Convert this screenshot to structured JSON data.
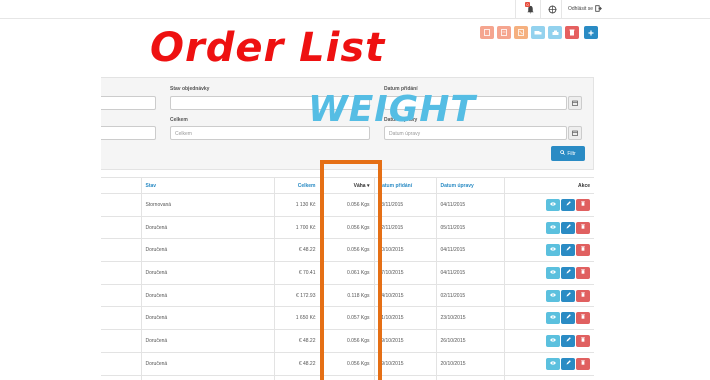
{
  "topbar": {
    "notification_count": "0",
    "logout_label": "Odhlásit se"
  },
  "icons": {
    "bell": "bell-icon",
    "globe": "globe-icon",
    "logout": "logout-icon",
    "calendar": "calendar-icon",
    "search": "search-icon",
    "eye": "eye-icon",
    "pencil": "pencil-icon",
    "trash": "trash-icon",
    "sort": "sort-icon"
  },
  "overlay": {
    "title": "Order List",
    "subtitle": "WEIGHT"
  },
  "toolbar_colors": [
    "#f39c82",
    "#f39c82",
    "#f3a77b",
    "#8fd0ee",
    "#8fd0ee",
    "#e06060",
    "#2a8bc4"
  ],
  "filters": {
    "state_label": "Stav objednávky",
    "total_label": "Celkem",
    "total_placeholder": "Celkem",
    "date_added_label": "Datum přidání",
    "date_modified_label": "Datum úpravy",
    "date_modified_placeholder": "Datum úpravy",
    "filter_button": "Filtr"
  },
  "table": {
    "headers": {
      "status": "Stav",
      "total": "Celkem",
      "weight": "Váha",
      "date_added": "Datum přidání",
      "date_modified": "Datum úpravy",
      "action": "Akce"
    },
    "rows": [
      {
        "status": "Stornovaná",
        "total": "1 130 Kč",
        "weight": "0.056 Kgs",
        "date_added": "03/11/2015",
        "date_modified": "04/11/2015"
      },
      {
        "status": "Doručená",
        "total": "1 700 Kč",
        "weight": "0.056 Kgs",
        "date_added": "02/11/2015",
        "date_modified": "05/11/2015"
      },
      {
        "status": "Doručená",
        "total": "€ 48.22",
        "weight": "0.056 Kgs",
        "date_added": "30/10/2015",
        "date_modified": "04/11/2015"
      },
      {
        "status": "Doručená",
        "total": "€ 70.41",
        "weight": "0.061 Kgs",
        "date_added": "27/10/2015",
        "date_modified": "04/11/2015"
      },
      {
        "status": "Doručená",
        "total": "€ 172.93",
        "weight": "0.118 Kgs",
        "date_added": "24/10/2015",
        "date_modified": "02/11/2015"
      },
      {
        "status": "Doručená",
        "total": "1 650 Kč",
        "weight": "0.057 Kgs",
        "date_added": "21/10/2015",
        "date_modified": "23/10/2015"
      },
      {
        "status": "Doručená",
        "total": "€ 48.22",
        "weight": "0.056 Kgs",
        "date_added": "19/10/2015",
        "date_modified": "26/10/2015"
      },
      {
        "status": "Doručená",
        "total": "€ 48.22",
        "weight": "0.056 Kgs",
        "date_added": "19/10/2015",
        "date_modified": "20/10/2015"
      },
      {
        "status": "Doručená",
        "total": "2 200 Kč",
        "weight": "0.056 Kgs",
        "date_added": "18/10/2015",
        "date_modified": "19/10/2015"
      }
    ]
  }
}
